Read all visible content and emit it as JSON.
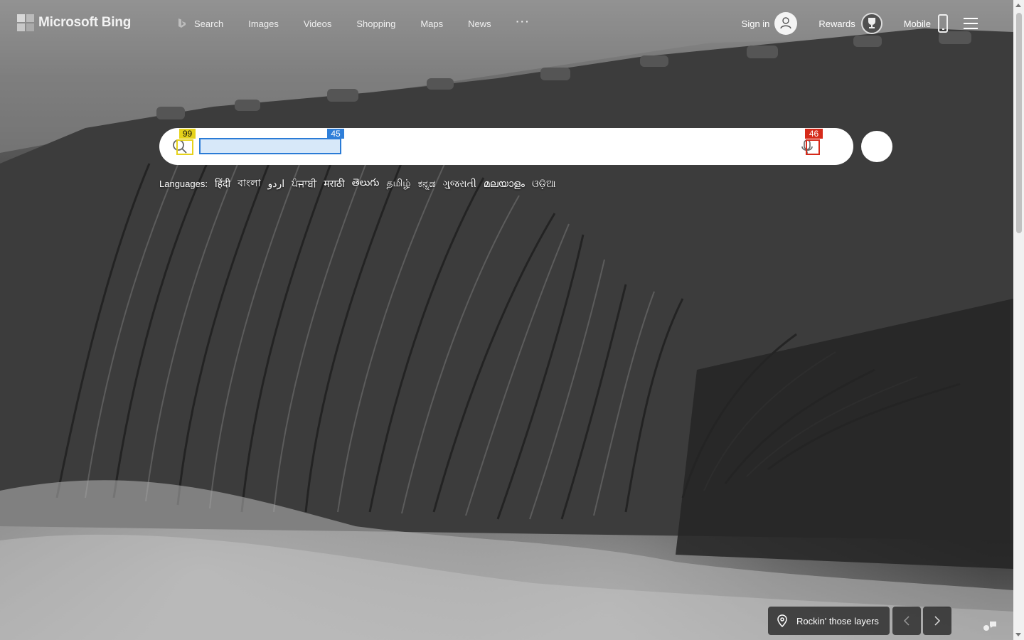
{
  "header": {
    "brand": "Microsoft Bing",
    "nav": [
      {
        "label": "Search",
        "icon": "bing-search-icon"
      },
      {
        "label": "Images"
      },
      {
        "label": "Videos"
      },
      {
        "label": "Shopping"
      },
      {
        "label": "Maps"
      },
      {
        "label": "News"
      }
    ],
    "more": "···",
    "sign_in": "Sign in",
    "rewards": "Rewards",
    "mobile": "Mobile"
  },
  "search": {
    "value": "",
    "placeholder": "",
    "badges": {
      "search_icon": "99",
      "input": "45",
      "mic": "46"
    }
  },
  "languages": {
    "label": "Languages:",
    "items": [
      "हिंदी",
      "বাংলা",
      "اردو",
      "ਪੰਜਾਬੀ",
      "मराठी",
      "తెలుగు",
      "தமிழ்",
      "ಕನ್ನಡ",
      "ગુજરાતી",
      "മലയാളം",
      "ଓଡ଼ିଆ"
    ]
  },
  "image_info": {
    "caption": "Rockin' those layers"
  },
  "colors": {
    "accent_blue": "#2f7fd9",
    "badge_yellow": "#e6d21a",
    "badge_red": "#d62a1a"
  }
}
